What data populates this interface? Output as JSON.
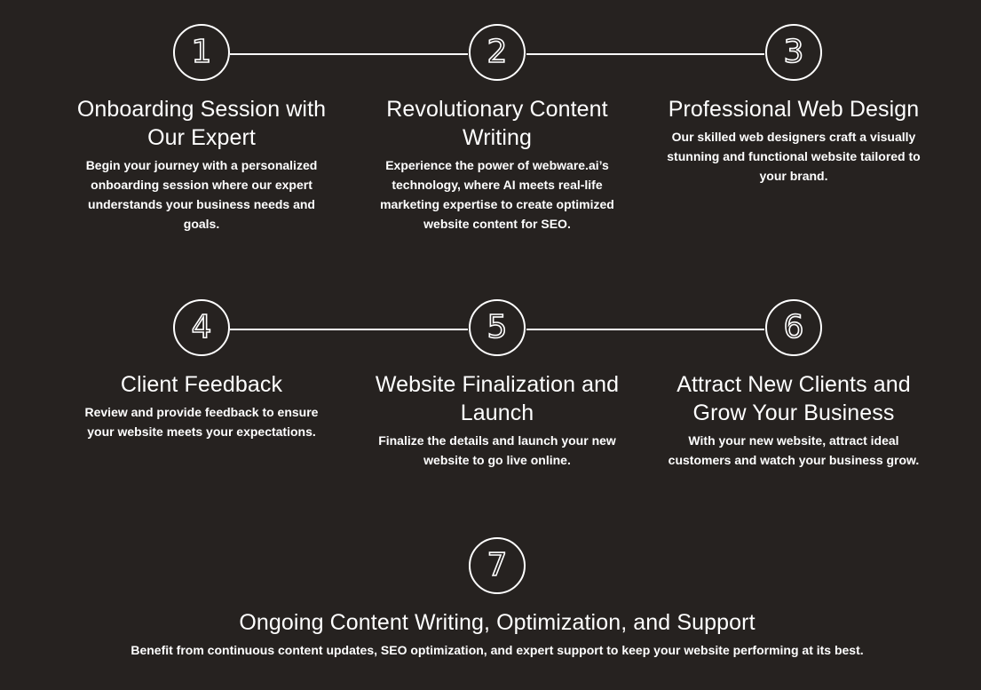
{
  "colors": {
    "background": "#262220",
    "foreground": "#ffffff"
  },
  "steps": [
    {
      "number": "1",
      "title": "Onboarding Session with Our Expert",
      "description": "Begin your journey with a personalized onboarding session where our expert understands your business needs and goals."
    },
    {
      "number": "2",
      "title": "Revolutionary Content Writing",
      "description": "Experience the power of webware.ai’s technology, where AI meets real-life marketing expertise to create optimized website content for SEO."
    },
    {
      "number": "3",
      "title": "Professional Web Design",
      "description": "Our skilled web designers craft a visually stunning and functional website tailored to your brand."
    },
    {
      "number": "4",
      "title": "Client Feedback",
      "description": "Review and provide feedback to ensure your website meets your expectations."
    },
    {
      "number": "5",
      "title": "Website Finalization and Launch",
      "description": "Finalize the details and launch your new website to go live online."
    },
    {
      "number": "6",
      "title": "Attract New Clients and Grow Your Business",
      "description": "With your new website, attract ideal customers and watch your business grow."
    },
    {
      "number": "7",
      "title": "Ongoing Content Writing, Optimization, and Support",
      "description": "Benefit from continuous content updates, SEO optimization, and expert support to keep your website performing at its best."
    }
  ]
}
